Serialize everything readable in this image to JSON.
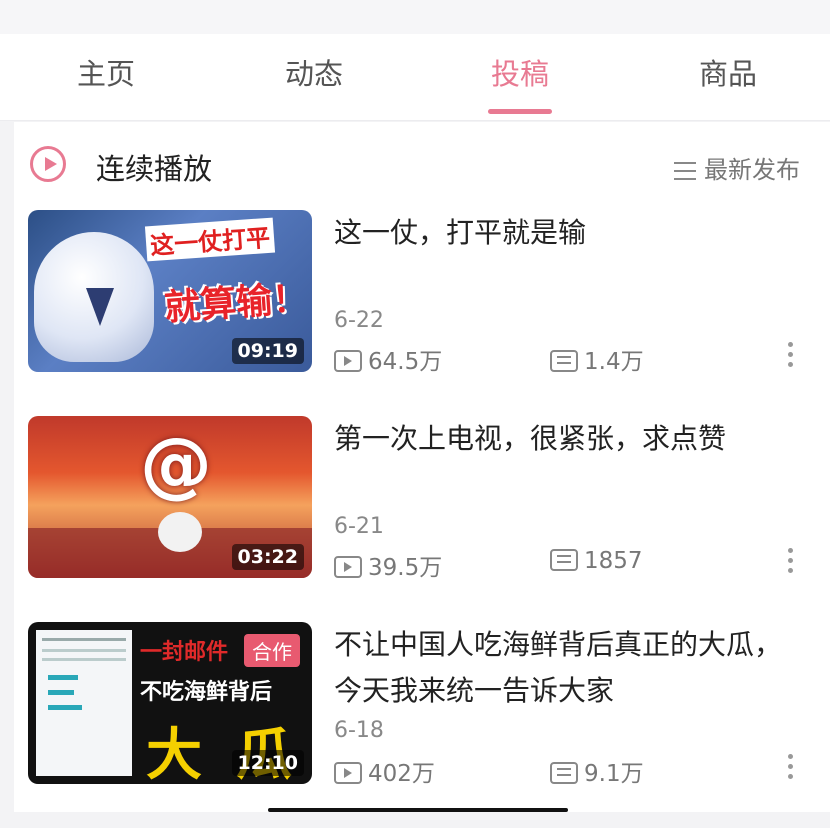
{
  "tabs": [
    {
      "label": "主页",
      "active": false
    },
    {
      "label": "动态",
      "active": false
    },
    {
      "label": "投稿",
      "active": true
    },
    {
      "label": "商品",
      "active": false
    }
  ],
  "playbar": {
    "label": "连续播放",
    "icon": "play-circle-icon",
    "sort_label": "最新发布",
    "sort_icon": "sort-lines-icon"
  },
  "videos": [
    {
      "title": "这一仗，打平就是输",
      "date": "6-22",
      "views": "64.5万",
      "danmaku": "1.4万",
      "duration": "09:19",
      "cover_text": [
        "这一仗打平",
        "就算输！"
      ]
    },
    {
      "title": "第一次上电视，很紧张，求点赞",
      "date": "6-21",
      "views": "39.5万",
      "danmaku": "1857",
      "duration": "03:22",
      "cover_text": [
        "@"
      ]
    },
    {
      "title": "不让中国人吃海鲜背后真正的大瓜，今天我来统一告诉大家",
      "date": "6-18",
      "views": "402万",
      "danmaku": "9.1万",
      "duration": "12:10",
      "cover_text": [
        "一封邮件",
        "不吃海鲜背后",
        "大",
        "瓜"
      ],
      "badge": "合作"
    }
  ],
  "colors": {
    "accent": "#e87a92",
    "text": "#222222",
    "muted": "#888888"
  }
}
